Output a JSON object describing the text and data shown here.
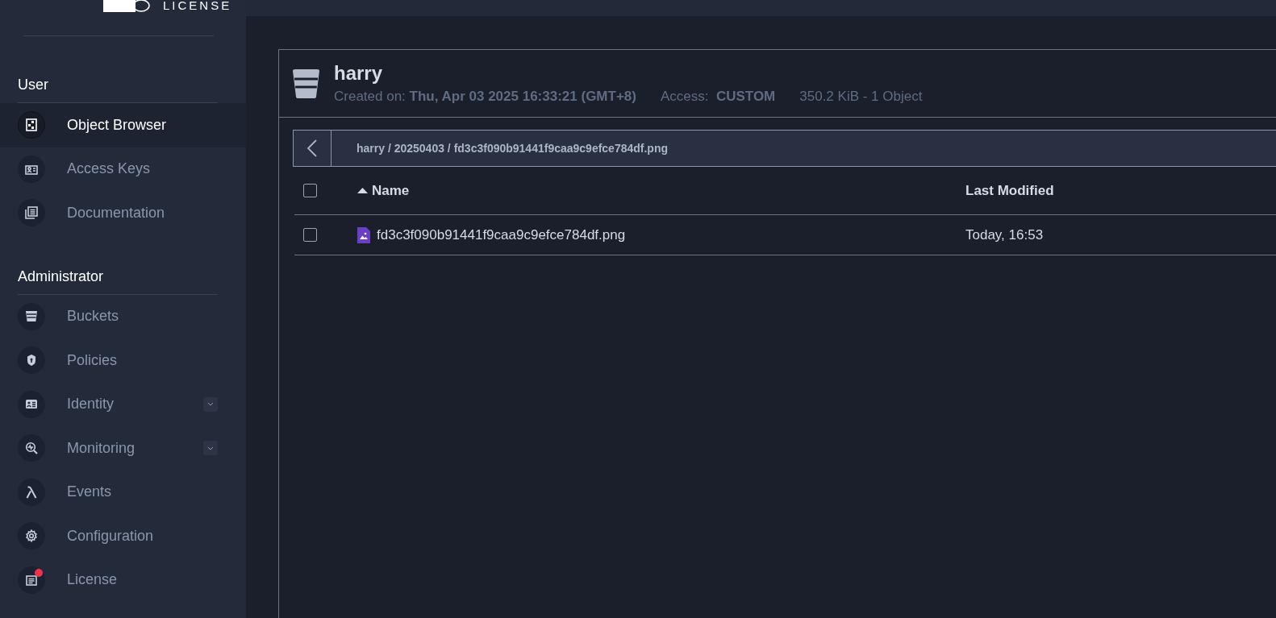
{
  "logo": {
    "text": "LICENSE"
  },
  "sidebar": {
    "sections": [
      {
        "title": "User",
        "items": [
          {
            "label": "Object Browser",
            "selected": true,
            "expandable": false,
            "notification": false
          },
          {
            "label": "Access Keys",
            "selected": false,
            "expandable": false,
            "notification": false
          },
          {
            "label": "Documentation",
            "selected": false,
            "expandable": false,
            "notification": false
          }
        ]
      },
      {
        "title": "Administrator",
        "items": [
          {
            "label": "Buckets",
            "selected": false,
            "expandable": false,
            "notification": false
          },
          {
            "label": "Policies",
            "selected": false,
            "expandable": false,
            "notification": false
          },
          {
            "label": "Identity",
            "selected": false,
            "expandable": true,
            "notification": false
          },
          {
            "label": "Monitoring",
            "selected": false,
            "expandable": true,
            "notification": false
          },
          {
            "label": "Events",
            "selected": false,
            "expandable": false,
            "notification": false
          },
          {
            "label": "Configuration",
            "selected": false,
            "expandable": false,
            "notification": false
          },
          {
            "label": "License",
            "selected": false,
            "expandable": false,
            "notification": true
          }
        ]
      }
    ]
  },
  "bucket": {
    "name": "harry",
    "created_label": "Created on:",
    "created_value": "Thu, Apr 03 2025 16:33:21 (GMT+8)",
    "access_label": "Access:",
    "access_value": "CUSTOM",
    "summary": "350.2 KiB - 1 Object"
  },
  "breadcrumb": {
    "path": "harry / 20250403 / fd3c3f090b91441f9caa9c9efce784df.png"
  },
  "table": {
    "select_all_checked": false,
    "columns": [
      {
        "label": "Name",
        "sorted": true
      },
      {
        "label": "Last Modified",
        "sorted": false
      }
    ],
    "rows": [
      {
        "name": "fd3c3f090b91441f9caa9c9efce784df.png",
        "modified": "Today, 16:53",
        "checked": false
      }
    ]
  }
}
